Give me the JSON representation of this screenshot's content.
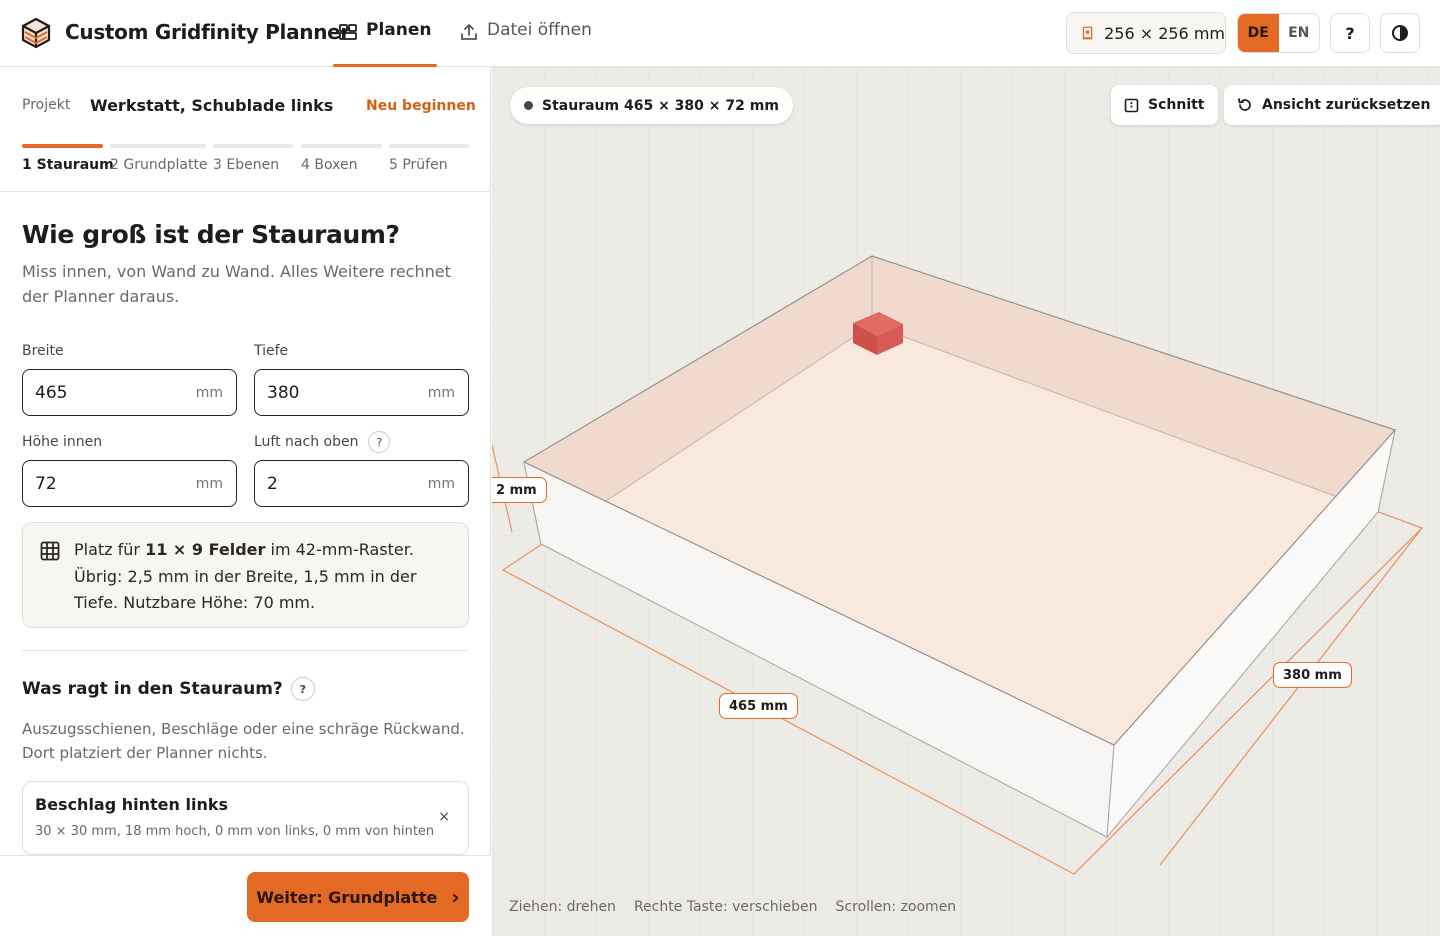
{
  "app": {
    "title": "Custom Gridfinity Planner"
  },
  "nav": {
    "plan_label": "Planen",
    "open_label": "Datei öffnen"
  },
  "header": {
    "printer_size": "256 × 256 mm",
    "lang_de": "DE",
    "lang_en": "EN",
    "lang_active": "DE",
    "help_label": "?"
  },
  "project": {
    "label": "Projekt",
    "name": "Werkstatt, Schublade links",
    "restart_label": "Neu beginnen"
  },
  "steps": [
    {
      "label": "1 Stauraum",
      "active": true
    },
    {
      "label": "2 Grundplatte",
      "active": false
    },
    {
      "label": "3 Ebenen",
      "active": false
    },
    {
      "label": "4 Boxen",
      "active": false
    },
    {
      "label": "5 Prüfen",
      "active": false
    }
  ],
  "question": {
    "title": "Wie groß ist der Stauraum?",
    "subtitle": "Miss innen, von Wand zu Wand. Alles Weitere rechnet der Planner daraus."
  },
  "fields": {
    "width": {
      "label": "Breite",
      "value": "465",
      "unit": "mm"
    },
    "depth": {
      "label": "Tiefe",
      "value": "380",
      "unit": "mm"
    },
    "height": {
      "label": "Höhe innen",
      "value": "72",
      "unit": "mm"
    },
    "clearance": {
      "label": "Luft nach oben",
      "value": "2",
      "unit": "mm",
      "help": "?"
    }
  },
  "info": {
    "pre": "Platz für ",
    "fields": "11 × 9 Felder",
    "post": " im 42-mm-Raster. Übrig: 2,5 mm in der Breite, 1,5 mm in der Tiefe. Nutzbare Höhe: 70 mm."
  },
  "obstacles": {
    "title": "Was ragt in den Stauraum?",
    "help": "?",
    "subtitle": "Auszugsschienen, Beschläge oder eine schräge Rückwand. Dort platziert der Planner nichts.",
    "items": [
      {
        "title": "Beschlag hinten links",
        "desc": "30 × 30 mm, 18 mm hoch, 0 mm von links, 0 mm von hinten",
        "remove": "×"
      }
    ]
  },
  "footer": {
    "next_label": "Weiter: Grundplatte",
    "next_arrow": "›"
  },
  "viewport": {
    "space_pill": "Stauraum 465 × 380 × 72 mm",
    "section_label": "Schnitt",
    "reset_label": "Ansicht zurücksetzen",
    "dim_width": "465 mm",
    "dim_depth": "380 mm",
    "dim_height": "2 mm",
    "hints": [
      "Ziehen: drehen",
      "Rechte Taste: verschieben",
      "Scrollen: zoomen"
    ]
  },
  "colors": {
    "accent": "#e26a24",
    "obstacle": "#d9534f"
  }
}
